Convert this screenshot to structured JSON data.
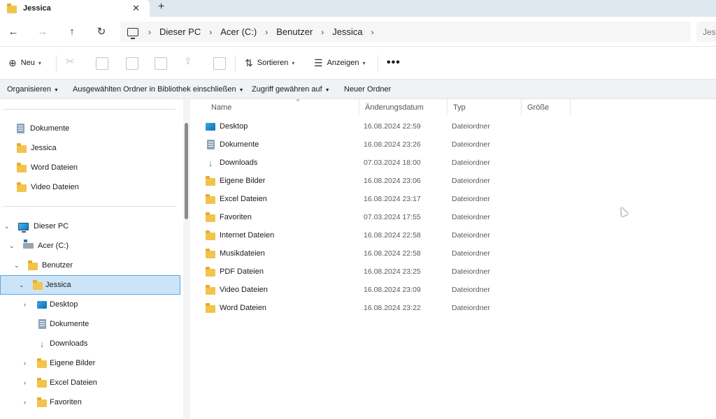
{
  "tab": {
    "title": "Jessica",
    "close_icon": "close-icon",
    "newtab_icon": "plus-icon"
  },
  "address": {
    "breadcrumbs": [
      "Dieser PC",
      "Acer (C:)",
      "Benutzer",
      "Jessica"
    ],
    "search_placeholder": "Jess"
  },
  "toolbar": {
    "new_label": "Neu",
    "sort_label": "Sortieren",
    "view_label": "Anzeigen",
    "more_label": "•••"
  },
  "ribbon": {
    "organize": "Organisieren",
    "include_library": "Ausgewählten Ordner in Bibliothek einschließen",
    "grant_access": "Zugriff gewähren auf",
    "new_folder": "Neuer Ordner"
  },
  "navpane": {
    "quick_access": [
      {
        "label": "Dokumente",
        "icon": "documents-icon"
      },
      {
        "label": "Jessica",
        "icon": "folder-icon"
      },
      {
        "label": "Word Dateien",
        "icon": "folder-icon"
      },
      {
        "label": "Video Dateien",
        "icon": "folder-icon"
      }
    ],
    "tree": [
      {
        "label": "Dieser PC",
        "icon": "monitor-icon",
        "expanded": true
      },
      {
        "label": "Acer (C:)",
        "icon": "drive-icon",
        "expanded": true
      },
      {
        "label": "Benutzer",
        "icon": "folder-icon",
        "expanded": true
      },
      {
        "label": "Jessica",
        "icon": "folder-icon",
        "expanded": true,
        "selected": true
      },
      {
        "label": "Desktop",
        "icon": "desktop-icon",
        "expandable": true
      },
      {
        "label": "Dokumente",
        "icon": "documents-icon",
        "expandable": false
      },
      {
        "label": "Downloads",
        "icon": "download-icon",
        "expandable": false
      },
      {
        "label": "Eigene Bilder",
        "icon": "folder-icon",
        "expandable": true
      },
      {
        "label": "Excel Dateien",
        "icon": "folder-icon",
        "expandable": true
      },
      {
        "label": "Favoriten",
        "icon": "folder-icon",
        "expandable": true
      }
    ]
  },
  "columns": {
    "name": "Name",
    "modified": "Änderungsdatum",
    "type": "Typ",
    "size": "Größe"
  },
  "files": [
    {
      "name": "Desktop",
      "date": "16.08.2024 22:59",
      "type": "Dateiordner",
      "icon": "desktop-icon"
    },
    {
      "name": "Dokumente",
      "date": "16.08.2024 23:26",
      "type": "Dateiordner",
      "icon": "documents-icon"
    },
    {
      "name": "Downloads",
      "date": "07.03.2024 18:00",
      "type": "Dateiordner",
      "icon": "download-icon"
    },
    {
      "name": "Eigene Bilder",
      "date": "16.08.2024 23:06",
      "type": "Dateiordner",
      "icon": "folder-icon"
    },
    {
      "name": "Excel Dateien",
      "date": "16.08.2024 23:17",
      "type": "Dateiordner",
      "icon": "folder-icon"
    },
    {
      "name": "Favoriten",
      "date": "07.03.2024 17:55",
      "type": "Dateiordner",
      "icon": "folder-icon"
    },
    {
      "name": "Internet Dateien",
      "date": "16.08.2024 22:58",
      "type": "Dateiordner",
      "icon": "folder-icon"
    },
    {
      "name": "Musikdateien",
      "date": "16.08.2024 22:58",
      "type": "Dateiordner",
      "icon": "folder-icon"
    },
    {
      "name": "PDF Dateien",
      "date": "16.08.2024 23:25",
      "type": "Dateiordner",
      "icon": "folder-icon"
    },
    {
      "name": "Video Dateien",
      "date": "16.08.2024 23:09",
      "type": "Dateiordner",
      "icon": "folder-icon"
    },
    {
      "name": "Word Dateien",
      "date": "16.08.2024 23:22",
      "type": "Dateiordner",
      "icon": "folder-icon"
    }
  ],
  "colors": {
    "selection_bg": "#cce4f7",
    "selection_border": "#5ea7e0",
    "folder": "#f2c44d",
    "tabbar": "#dfe8ef"
  }
}
